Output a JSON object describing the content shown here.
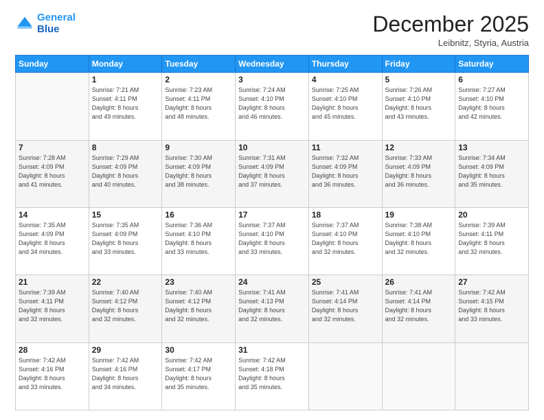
{
  "header": {
    "logo_line1": "General",
    "logo_line2": "Blue",
    "month": "December 2025",
    "location": "Leibnitz, Styria, Austria"
  },
  "weekdays": [
    "Sunday",
    "Monday",
    "Tuesday",
    "Wednesday",
    "Thursday",
    "Friday",
    "Saturday"
  ],
  "weeks": [
    [
      {
        "day": "",
        "info": ""
      },
      {
        "day": "1",
        "info": "Sunrise: 7:21 AM\nSunset: 4:11 PM\nDaylight: 8 hours\nand 49 minutes."
      },
      {
        "day": "2",
        "info": "Sunrise: 7:23 AM\nSunset: 4:11 PM\nDaylight: 8 hours\nand 48 minutes."
      },
      {
        "day": "3",
        "info": "Sunrise: 7:24 AM\nSunset: 4:10 PM\nDaylight: 8 hours\nand 46 minutes."
      },
      {
        "day": "4",
        "info": "Sunrise: 7:25 AM\nSunset: 4:10 PM\nDaylight: 8 hours\nand 45 minutes."
      },
      {
        "day": "5",
        "info": "Sunrise: 7:26 AM\nSunset: 4:10 PM\nDaylight: 8 hours\nand 43 minutes."
      },
      {
        "day": "6",
        "info": "Sunrise: 7:27 AM\nSunset: 4:10 PM\nDaylight: 8 hours\nand 42 minutes."
      }
    ],
    [
      {
        "day": "7",
        "info": "Sunrise: 7:28 AM\nSunset: 4:09 PM\nDaylight: 8 hours\nand 41 minutes."
      },
      {
        "day": "8",
        "info": "Sunrise: 7:29 AM\nSunset: 4:09 PM\nDaylight: 8 hours\nand 40 minutes."
      },
      {
        "day": "9",
        "info": "Sunrise: 7:30 AM\nSunset: 4:09 PM\nDaylight: 8 hours\nand 38 minutes."
      },
      {
        "day": "10",
        "info": "Sunrise: 7:31 AM\nSunset: 4:09 PM\nDaylight: 8 hours\nand 37 minutes."
      },
      {
        "day": "11",
        "info": "Sunrise: 7:32 AM\nSunset: 4:09 PM\nDaylight: 8 hours\nand 36 minutes."
      },
      {
        "day": "12",
        "info": "Sunrise: 7:33 AM\nSunset: 4:09 PM\nDaylight: 8 hours\nand 36 minutes."
      },
      {
        "day": "13",
        "info": "Sunrise: 7:34 AM\nSunset: 4:09 PM\nDaylight: 8 hours\nand 35 minutes."
      }
    ],
    [
      {
        "day": "14",
        "info": "Sunrise: 7:35 AM\nSunset: 4:09 PM\nDaylight: 8 hours\nand 34 minutes."
      },
      {
        "day": "15",
        "info": "Sunrise: 7:35 AM\nSunset: 4:09 PM\nDaylight: 8 hours\nand 33 minutes."
      },
      {
        "day": "16",
        "info": "Sunrise: 7:36 AM\nSunset: 4:10 PM\nDaylight: 8 hours\nand 33 minutes."
      },
      {
        "day": "17",
        "info": "Sunrise: 7:37 AM\nSunset: 4:10 PM\nDaylight: 8 hours\nand 33 minutes."
      },
      {
        "day": "18",
        "info": "Sunrise: 7:37 AM\nSunset: 4:10 PM\nDaylight: 8 hours\nand 32 minutes."
      },
      {
        "day": "19",
        "info": "Sunrise: 7:38 AM\nSunset: 4:10 PM\nDaylight: 8 hours\nand 32 minutes."
      },
      {
        "day": "20",
        "info": "Sunrise: 7:39 AM\nSunset: 4:11 PM\nDaylight: 8 hours\nand 32 minutes."
      }
    ],
    [
      {
        "day": "21",
        "info": "Sunrise: 7:39 AM\nSunset: 4:11 PM\nDaylight: 8 hours\nand 32 minutes."
      },
      {
        "day": "22",
        "info": "Sunrise: 7:40 AM\nSunset: 4:12 PM\nDaylight: 8 hours\nand 32 minutes."
      },
      {
        "day": "23",
        "info": "Sunrise: 7:40 AM\nSunset: 4:12 PM\nDaylight: 8 hours\nand 32 minutes."
      },
      {
        "day": "24",
        "info": "Sunrise: 7:41 AM\nSunset: 4:13 PM\nDaylight: 8 hours\nand 32 minutes."
      },
      {
        "day": "25",
        "info": "Sunrise: 7:41 AM\nSunset: 4:14 PM\nDaylight: 8 hours\nand 32 minutes."
      },
      {
        "day": "26",
        "info": "Sunrise: 7:41 AM\nSunset: 4:14 PM\nDaylight: 8 hours\nand 32 minutes."
      },
      {
        "day": "27",
        "info": "Sunrise: 7:42 AM\nSunset: 4:15 PM\nDaylight: 8 hours\nand 33 minutes."
      }
    ],
    [
      {
        "day": "28",
        "info": "Sunrise: 7:42 AM\nSunset: 4:16 PM\nDaylight: 8 hours\nand 33 minutes."
      },
      {
        "day": "29",
        "info": "Sunrise: 7:42 AM\nSunset: 4:16 PM\nDaylight: 8 hours\nand 34 minutes."
      },
      {
        "day": "30",
        "info": "Sunrise: 7:42 AM\nSunset: 4:17 PM\nDaylight: 8 hours\nand 35 minutes."
      },
      {
        "day": "31",
        "info": "Sunrise: 7:42 AM\nSunset: 4:18 PM\nDaylight: 8 hours\nand 35 minutes."
      },
      {
        "day": "",
        "info": ""
      },
      {
        "day": "",
        "info": ""
      },
      {
        "day": "",
        "info": ""
      }
    ]
  ]
}
